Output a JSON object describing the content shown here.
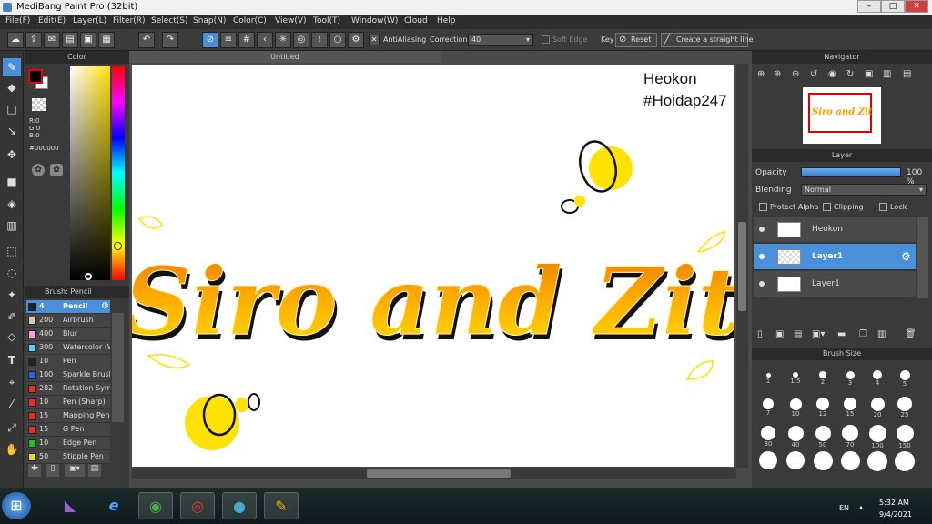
{
  "window": {
    "title": "MediBang Paint Pro (32bit)",
    "minimize": "–",
    "maximize": "□",
    "close": "✕"
  },
  "menu": [
    "File(F)",
    "Edit(E)",
    "Layer(L)",
    "Filter(R)",
    "Select(S)",
    "Snap(N)",
    "Color(C)",
    "View(V)",
    "Tool(T)",
    "Window(W)",
    "Cloud",
    "Help"
  ],
  "toolbar": {
    "antialiasing": "AntiAliasing",
    "correction_label": "Correction",
    "correction_value": "40",
    "soft_edge": "Soft Edge",
    "key_label": "Key",
    "reset": "Reset",
    "straight_line": "Create a straight line"
  },
  "color_panel": {
    "title": "Color",
    "r": "R:0",
    "g": "G:0",
    "b": "B:0",
    "hex": "#000000"
  },
  "brush_panel": {
    "title": "Brush: Pencil",
    "items": [
      {
        "size": "4",
        "name": "Pencil",
        "color": "#222222"
      },
      {
        "size": "200",
        "name": "Airbrush",
        "color": "#cccccc"
      },
      {
        "size": "400",
        "name": "Blur",
        "color": "#f0a0e0"
      },
      {
        "size": "300",
        "name": "Watercolor (W",
        "color": "#60d0f0"
      },
      {
        "size": "10",
        "name": "Pen",
        "color": "#222222"
      },
      {
        "size": "100",
        "name": "Sparkle Brush",
        "color": "#3060e0"
      },
      {
        "size": "282",
        "name": "Rotation Sym",
        "color": "#e03030"
      },
      {
        "size": "10",
        "name": "Pen (Sharp)",
        "color": "#e03030"
      },
      {
        "size": "15",
        "name": "Mapping Pen",
        "color": "#e03030"
      },
      {
        "size": "15",
        "name": "G Pen",
        "color": "#e03030"
      },
      {
        "size": "10",
        "name": "Edge Pen",
        "color": "#20c020"
      },
      {
        "size": "50",
        "name": "Stipple Pen",
        "color": "#e0e020"
      }
    ]
  },
  "document": {
    "tab": "Untitled",
    "watermark_line1": "Heokon",
    "watermark_line2": "#Hoidap247",
    "artwork_text": "Siro and Zit"
  },
  "navigator": {
    "title": "Navigator"
  },
  "layer_panel": {
    "title": "Layer",
    "opacity_label": "Opacity",
    "opacity_value": "100 %",
    "opacity_fraction": 1.0,
    "blending_label": "Blending",
    "blending_value": "Normal",
    "protect_alpha": "Protect Alpha",
    "clipping": "Clipping",
    "lock": "Lock",
    "layers": [
      {
        "name": "Heokon"
      },
      {
        "name": "Layer1"
      },
      {
        "name": "Layer1"
      }
    ]
  },
  "brush_size": {
    "title": "Brush Size",
    "sizes": [
      "1",
      "1.5",
      "2",
      "3",
      "4",
      "5",
      "7",
      "10",
      "12",
      "15",
      "20",
      "25",
      "30",
      "40",
      "50",
      "70",
      "100",
      "150",
      "",
      "",
      "",
      "",
      "",
      ""
    ]
  },
  "taskbar": {
    "lang": "EN",
    "time": "5:32 AM",
    "date": "9/4/2021"
  },
  "colors": {
    "accent": "#4a90d9",
    "yellow": "#ffd700",
    "orange": "#f5a000"
  }
}
